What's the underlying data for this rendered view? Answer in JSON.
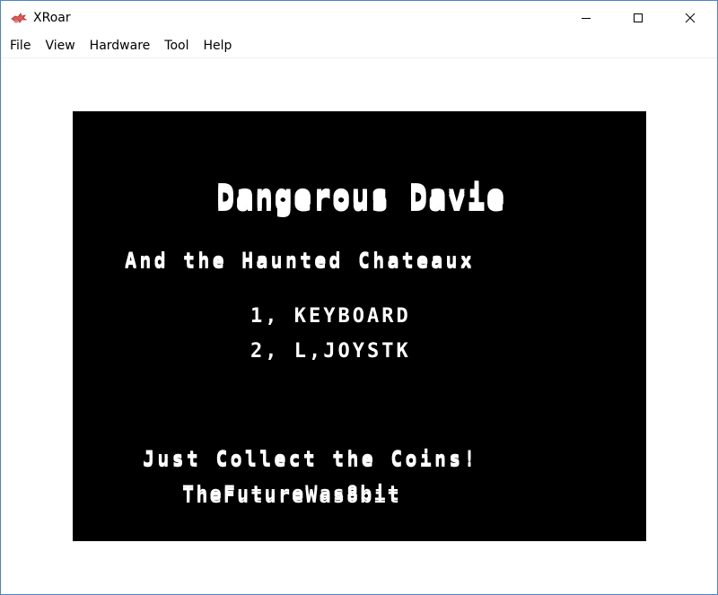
{
  "window": {
    "title": "XRoar",
    "accent_color": "#4a86c8",
    "icons": {
      "app": "xroar-dragon-icon",
      "minimize": "minimize-icon",
      "maximize": "maximize-icon",
      "close": "close-icon"
    }
  },
  "menubar": {
    "items": [
      {
        "label": "File"
      },
      {
        "label": "View"
      },
      {
        "label": "Hardware"
      },
      {
        "label": "Tool"
      },
      {
        "label": "Help"
      }
    ]
  },
  "screen": {
    "background": "#000000",
    "foreground": "#ffffff",
    "title": "Dangerous Davie",
    "subtitle": "And the Haunted Chateaux",
    "option_1": "1, KEYBOARD",
    "option_2": "2, L,JOYSTK",
    "tagline": "Just Collect the Coins!",
    "credit": "TheFutureWas8bit"
  }
}
